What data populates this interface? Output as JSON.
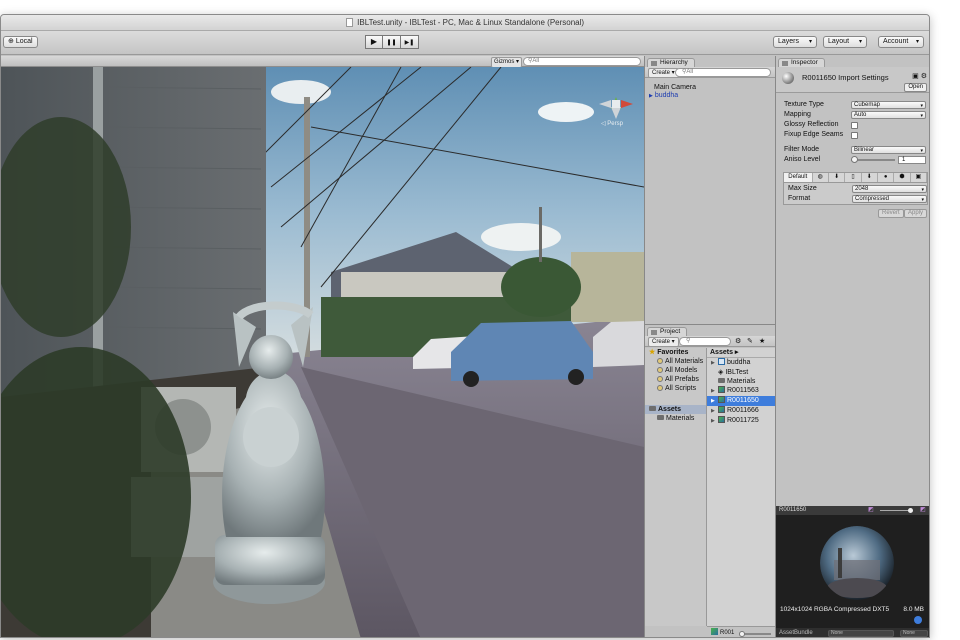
{
  "window": {
    "title": "IBLTest.unity - IBLTest - PC, Mac & Linux Standalone (Personal)"
  },
  "toolbar": {
    "local_label": "Local",
    "play_icon": "▶",
    "pause_icon": "❚❚",
    "step_icon": "▶❚",
    "layers_label": "Layers",
    "layout_label": "Layout",
    "account_label": "Account"
  },
  "scene": {
    "gizmos_label": "Gizmos ▾",
    "search_placeholder": "All",
    "persp_label": "◁ Persp"
  },
  "hierarchy": {
    "tab_label": "Hierarchy",
    "create_label": "Create ▾",
    "search_placeholder": "All",
    "items": [
      {
        "label": "Main Camera"
      },
      {
        "label": "buddha"
      }
    ]
  },
  "project": {
    "tab_label": "Project",
    "create_label": "Create ▾",
    "favorites": {
      "header": "Favorites",
      "items": [
        "All Materials",
        "All Models",
        "All Prefabs",
        "All Scripts"
      ]
    },
    "tree": {
      "assets": "Assets",
      "materials": "Materials"
    },
    "breadcrumb": "Assets ▸",
    "assets": [
      {
        "label": "buddha"
      },
      {
        "label": "IBLTest"
      },
      {
        "label": "Materials"
      },
      {
        "label": "R0011563"
      },
      {
        "label": "R0011650"
      },
      {
        "label": "R0011666"
      },
      {
        "label": "R0011725"
      }
    ],
    "footer_label": "R001"
  },
  "inspector": {
    "tab_label": "Inspector",
    "title": "R0011650 Import Settings",
    "open_label": "Open",
    "texture_type": {
      "label": "Texture Type",
      "value": "Cubemap"
    },
    "mapping": {
      "label": "Mapping",
      "value": "Auto"
    },
    "glossy_reflection": {
      "label": "Glossy Reflection"
    },
    "fixup_edge_seams": {
      "label": "Fixup Edge Seams"
    },
    "filter_mode": {
      "label": "Filter Mode",
      "value": "Bilinear"
    },
    "aniso_level": {
      "label": "Aniso Level",
      "value": "1"
    },
    "platform_tab": "Default",
    "max_size": {
      "label": "Max Size",
      "value": "2048"
    },
    "format": {
      "label": "Format",
      "value": "Compressed"
    },
    "revert_label": "Revert",
    "apply_label": "Apply"
  },
  "preview": {
    "title": "R0011650",
    "info": "1024x1024  RGBA Compressed DXT5",
    "size": "8.0 MB",
    "assetbundle_label": "AssetBundle",
    "bundle_value_1": "None",
    "bundle_value_2": "None"
  },
  "colors": {
    "selection": "#3e7ddc",
    "panel": "#c2c2c2",
    "prefab_text": "#1d3db0"
  }
}
